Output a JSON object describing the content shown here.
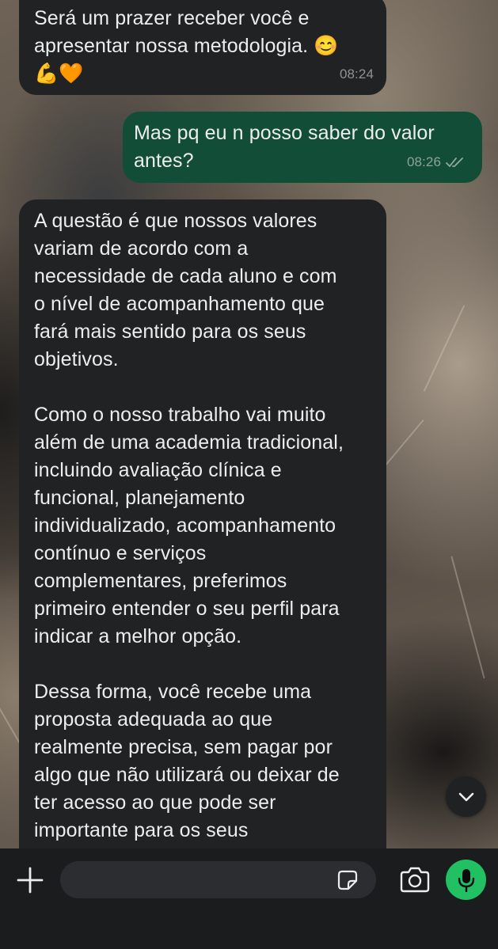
{
  "messages": [
    {
      "direction": "incoming",
      "text": "Será um prazer receber você e\napresentar nossa metodologia. 😊\n💪🧡",
      "time": "08:24"
    },
    {
      "direction": "outgoing",
      "text": "Mas pq eu n posso saber do valor\nantes?",
      "time": "08:26",
      "status": "read"
    },
    {
      "direction": "incoming",
      "text": "A questão é que nossos valores\nvariam de acordo com a\nnecessidade de cada aluno e com\no nível de acompanhamento que\nfará mais sentido para os seus\nobjetivos.\n\nComo o nosso trabalho vai muito\nalém de uma academia tradicional,\nincluindo avaliação clínica e\nfuncional, planejamento\nindividualizado, acompanhamento\ncontínuo e serviços\ncomplementares, preferimos\nprimeiro entender o seu perfil para\nindicar a melhor opção.\n\nDessa forma, você recebe uma\nproposta adequada ao que\nrealmente precisa, sem pagar por\nalgo que não utilizará ou deixar de\nter acesso ao que pode ser\nimportante para os seus"
    }
  ],
  "icons": {
    "read_receipt": "double-check-icon",
    "scroll_down": "chevron-down-icon",
    "attach": "plus-icon",
    "sticker": "sticker-icon",
    "camera": "camera-icon",
    "mic": "microphone-icon"
  },
  "composer": {
    "input_value": "",
    "placeholder": ""
  },
  "colors": {
    "incoming_bubble": "#202224",
    "outgoing_bubble": "#124D37",
    "mic_button": "#21C063",
    "composer_bar": "#1b1c1e"
  }
}
